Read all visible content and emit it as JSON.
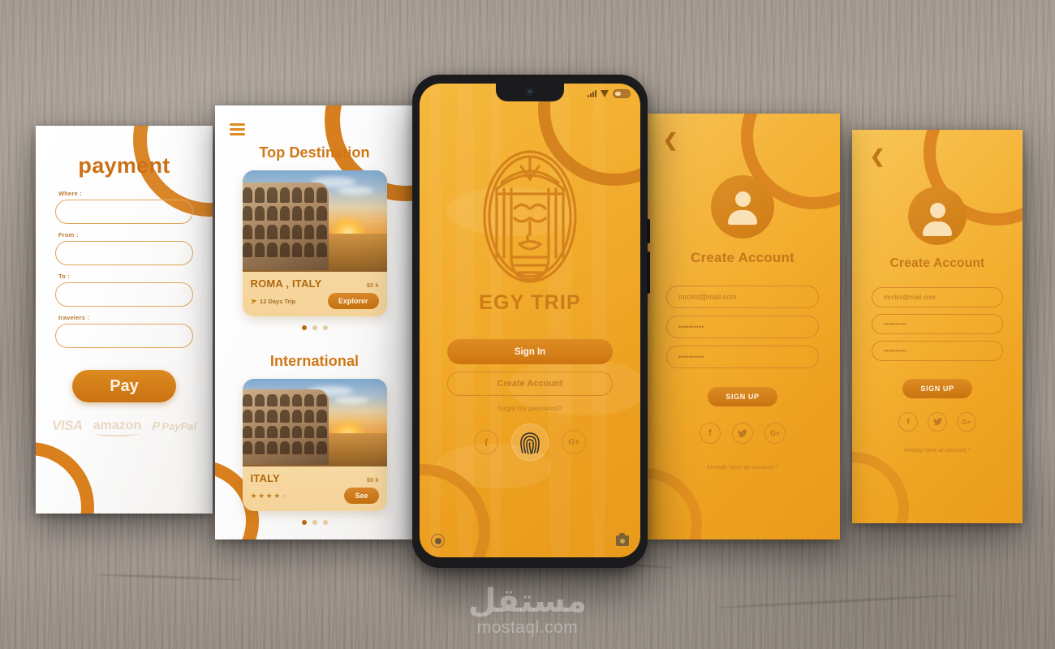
{
  "watermark": {
    "arabic": "مستقل",
    "latin": "mostaql.com"
  },
  "colors": {
    "brand_orange": "#cd7c17",
    "accent_orange": "#d77f1e",
    "button_orange": "#c97310",
    "screen_yellow": "#f2ab2c",
    "light_card": "#fae0b2",
    "text_on_dark": "#fff6e8"
  },
  "payment_screen": {
    "title": "payment",
    "fields": [
      {
        "label": "Where :",
        "value": "",
        "placeholder": ""
      },
      {
        "label": "From :",
        "value": "",
        "placeholder": ""
      },
      {
        "label": "To :",
        "value": "",
        "placeholder": ""
      },
      {
        "label": "travelers :",
        "value": "",
        "placeholder": ""
      }
    ],
    "pay_button": "Pay",
    "logos": [
      {
        "name": "visa-logo",
        "label": "VISA"
      },
      {
        "name": "amazon-logo",
        "label": "amazon"
      },
      {
        "name": "paypal-logo",
        "mark": "P",
        "label": "PayPal"
      }
    ]
  },
  "destination_screen": {
    "menu_icon": "hamburger-menu-icon",
    "section_top": {
      "title": "Top Destination",
      "card": {
        "place": "ROMA , ITALY",
        "price": "$5 k",
        "trip": "12 Days Trip",
        "trip_icon": "plane-icon",
        "action": "Explorer"
      },
      "dots": {
        "count": 3,
        "active": 0
      }
    },
    "section_intl": {
      "title": "International",
      "card": {
        "place": "ITALY",
        "price": "$5 k",
        "rating": 4,
        "rating_max": 5,
        "action": "See"
      },
      "dots": {
        "count": 3,
        "active": 0
      }
    }
  },
  "phone_screen": {
    "status": {
      "signal_icon": "signal-bars-icon",
      "wifi_icon": "wifi-icon",
      "battery_icon": "battery-icon"
    },
    "logo_alt": "pharaoh-cleopatra-logo",
    "brand": "EGY TRIP",
    "sign_in": "Sign In",
    "create_account": "Create Account",
    "forgot": "forgot my password?",
    "social": [
      {
        "name": "facebook-icon",
        "glyph": "f"
      },
      {
        "name": "fingerprint-icon",
        "glyph": ""
      },
      {
        "name": "google-plus-icon",
        "glyph": "G+"
      }
    ],
    "footer": {
      "record_icon": "record-icon",
      "camera_icon": "camera-icon"
    }
  },
  "create_account_screen_1": {
    "back_icon": "back-chevron-icon",
    "avatar_icon": "user-avatar-icon",
    "title": "Create Account",
    "fields": [
      {
        "name": "email-field",
        "value": "mrclint@mail.com"
      },
      {
        "name": "password-field",
        "value": "••••••••••"
      },
      {
        "name": "confirm-password-field",
        "value": "••••••••••"
      }
    ],
    "signup_button": "SIGN UP",
    "social": [
      {
        "name": "facebook-icon",
        "glyph": "f"
      },
      {
        "name": "twitter-icon",
        "glyph": "t"
      },
      {
        "name": "google-plus-icon",
        "glyph": "G+"
      }
    ],
    "footer": "Already have an account ?"
  },
  "create_account_screen_2": {
    "back_icon": "back-chevron-icon",
    "avatar_icon": "user-avatar-icon",
    "title": "Create Account",
    "fields": [
      {
        "name": "email-field",
        "value": "mrclint@mail.com"
      },
      {
        "name": "password-field",
        "value": "••••••••••"
      },
      {
        "name": "confirm-password-field",
        "value": "••••••••••"
      }
    ],
    "signup_button": "SIGN UP",
    "social": [
      {
        "name": "facebook-icon",
        "glyph": "f"
      },
      {
        "name": "twitter-icon",
        "glyph": "t"
      },
      {
        "name": "google-plus-icon",
        "glyph": "G+"
      }
    ],
    "footer": "Already have an account ?"
  }
}
